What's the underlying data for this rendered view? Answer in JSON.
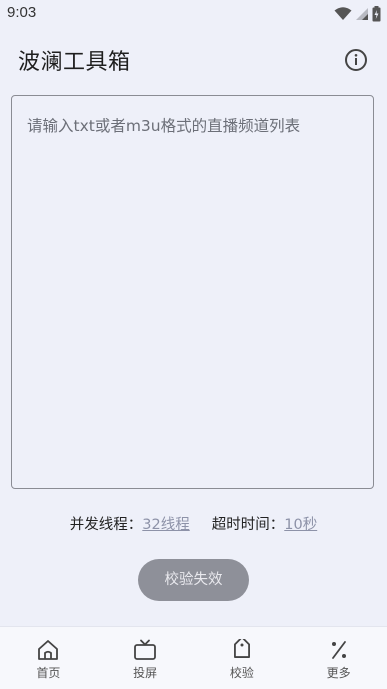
{
  "status_bar": {
    "time": "9:03"
  },
  "app_bar": {
    "title": "波澜工具箱"
  },
  "editor": {
    "value": "",
    "placeholder": "请输入txt或者m3u格式的直播频道列表"
  },
  "settings": {
    "threads_label": "并发线程：",
    "threads_value": "32线程",
    "timeout_label": "超时时间：",
    "timeout_value": "10秒"
  },
  "action": {
    "label": "校验失效"
  },
  "bottom_nav": {
    "items": [
      {
        "label": "首页",
        "icon": "home-icon"
      },
      {
        "label": "投屏",
        "icon": "tv-icon"
      },
      {
        "label": "校验",
        "icon": "tag-icon"
      },
      {
        "label": "更多",
        "icon": "percent-icon"
      }
    ]
  },
  "colors": {
    "background": "#eef0f9",
    "button": "#8e9099",
    "link": "#8d92a8"
  }
}
